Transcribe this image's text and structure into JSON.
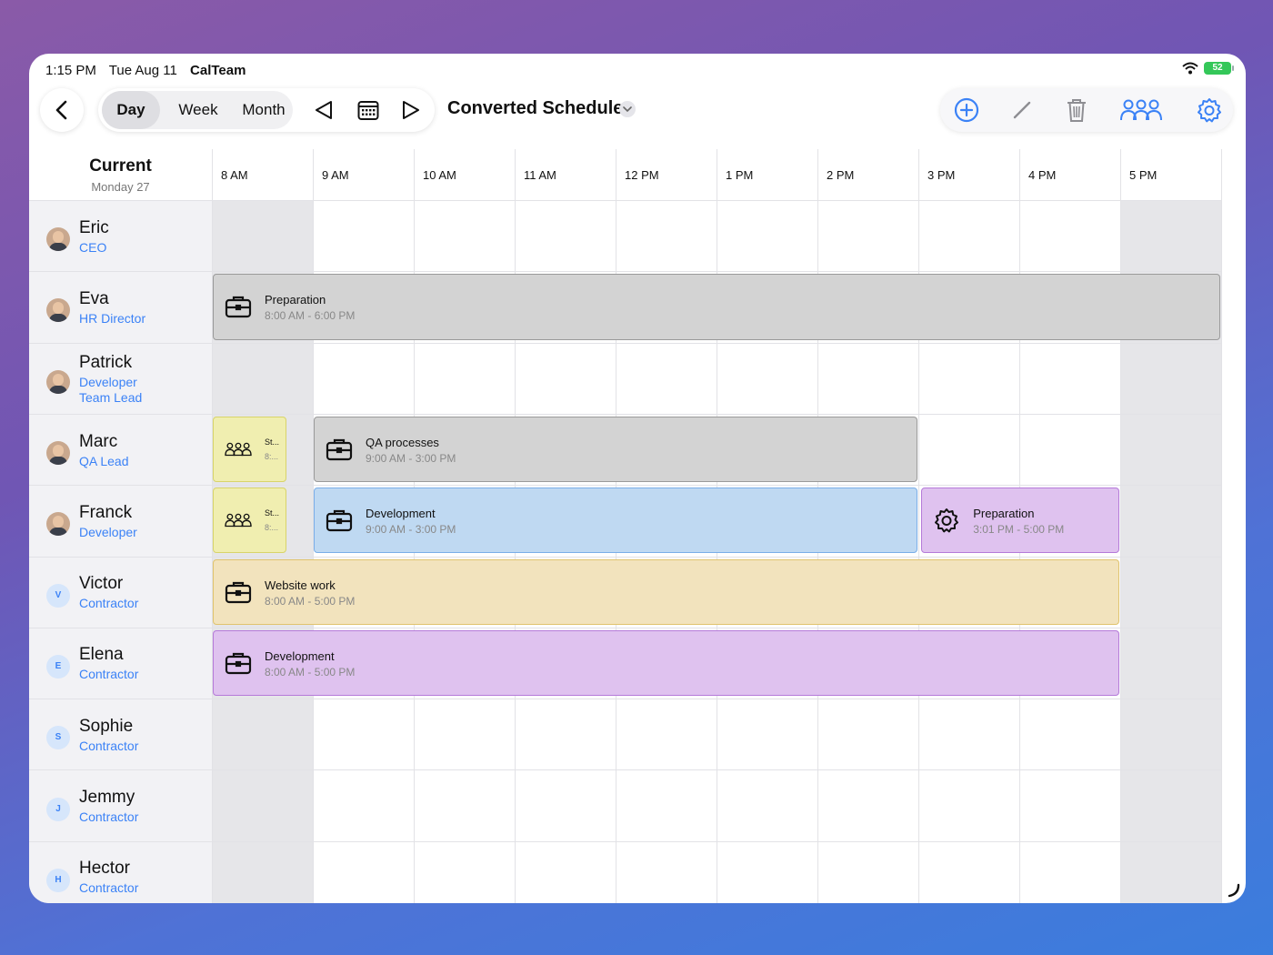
{
  "status": {
    "time": "1:15 PM",
    "date": "Tue Aug 11",
    "app": "CalTeam",
    "battery": "52"
  },
  "toolbar": {
    "views": [
      "Day",
      "Week",
      "Month"
    ],
    "selected_view": "Day",
    "title": "Converted Schedule"
  },
  "grid": {
    "current_label": "Current",
    "current_date": "Monday 27",
    "hours": [
      "8 AM",
      "9 AM",
      "10 AM",
      "11 AM",
      "12 PM",
      "1 PM",
      "2 PM",
      "3 PM",
      "4 PM",
      "5 PM"
    ]
  },
  "people": [
    {
      "name": "Eric",
      "role": "CEO",
      "avatar": "photo"
    },
    {
      "name": "Eva",
      "role": "HR Director",
      "avatar": "photo"
    },
    {
      "name": "Patrick",
      "role": "Developer Team Lead",
      "role_lines": [
        "Developer",
        "Team Lead"
      ],
      "avatar": "photo"
    },
    {
      "name": "Marc",
      "role": "QA Lead",
      "avatar": "photo"
    },
    {
      "name": "Franck",
      "role": "Developer",
      "avatar": "photo"
    },
    {
      "name": "Victor",
      "role": "Contractor",
      "avatar": "initial",
      "initial": "V"
    },
    {
      "name": "Elena",
      "role": "Contractor",
      "avatar": "initial",
      "initial": "E"
    },
    {
      "name": "Sophie",
      "role": "Contractor",
      "avatar": "initial",
      "initial": "S"
    },
    {
      "name": "Jemmy",
      "role": "Contractor",
      "avatar": "initial",
      "initial": "J"
    },
    {
      "name": "Hector",
      "role": "Contractor",
      "avatar": "initial",
      "initial": "H"
    }
  ],
  "events": [
    {
      "person": "Eva",
      "title": "Preparation",
      "time": "8:00 AM - 6:00 PM",
      "start": 8,
      "end": 18,
      "color": "#d3d3d3",
      "icon": "briefcase-icon"
    },
    {
      "person": "Marc",
      "title": "St...",
      "time": "8:...",
      "start": 8,
      "end": 8.75,
      "color": "#f0eeb0",
      "icon": "team-icon"
    },
    {
      "person": "Marc",
      "title": "QA processes",
      "time": "9:00 AM - 3:00 PM",
      "start": 9,
      "end": 15,
      "color": "#d3d3d3",
      "icon": "briefcase-icon"
    },
    {
      "person": "Franck",
      "title": "St...",
      "time": "8:...",
      "start": 8,
      "end": 8.75,
      "color": "#f0eeb0",
      "icon": "team-icon"
    },
    {
      "person": "Franck",
      "title": "Development",
      "time": "9:00 AM - 3:00 PM",
      "start": 9,
      "end": 15,
      "color": "#bfd9f2",
      "icon": "briefcase-icon"
    },
    {
      "person": "Franck",
      "title": "Preparation",
      "time": "3:01 PM - 5:00 PM",
      "start": 15.02,
      "end": 17,
      "color": "#dfc2ef",
      "icon": "gear-icon"
    },
    {
      "person": "Victor",
      "title": "Website work",
      "time": "8:00 AM - 5:00 PM",
      "start": 8,
      "end": 17,
      "color": "#f2e3bd",
      "icon": "briefcase-icon"
    },
    {
      "person": "Elena",
      "title": "Development",
      "time": "8:00 AM - 5:00 PM",
      "start": 8,
      "end": 17,
      "color": "#dfc2ef",
      "icon": "briefcase-icon"
    }
  ]
}
